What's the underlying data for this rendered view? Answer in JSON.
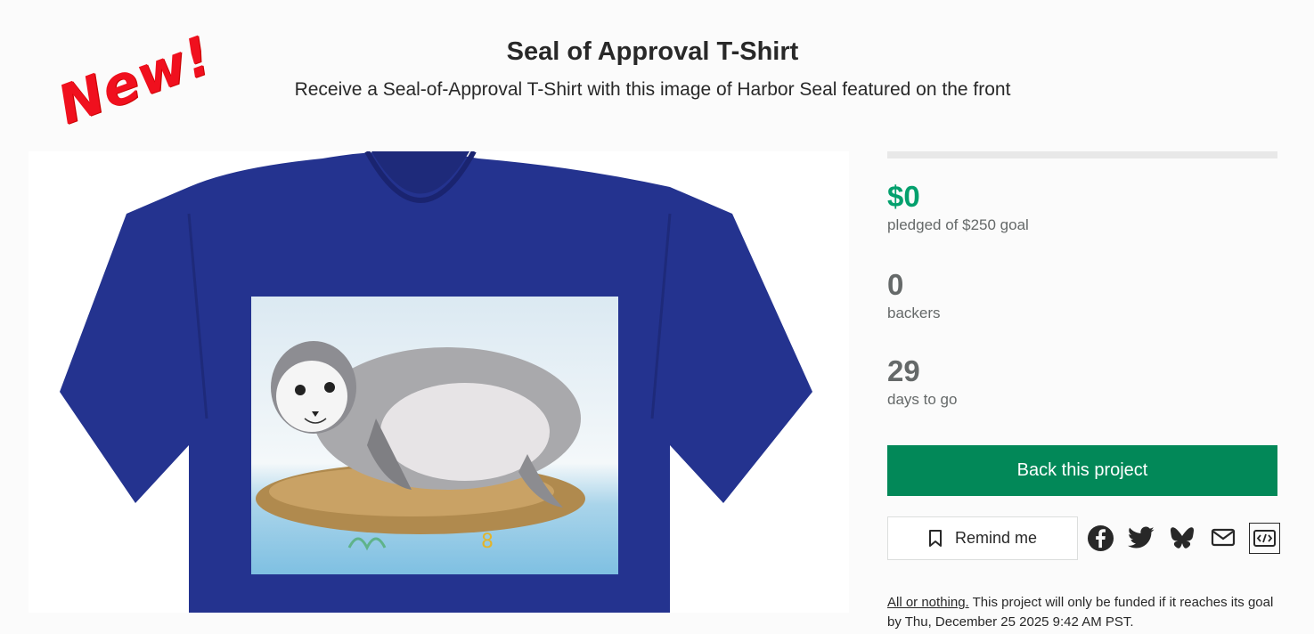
{
  "project": {
    "title": "Seal of Approval T-Shirt",
    "subtitle": "Receive a Seal-of-Approval T-Shirt with this image of Harbor Seal featured on the front",
    "badge": "New!"
  },
  "media": {
    "description_icon": "tshirt-image",
    "shirt_color": "#24338f"
  },
  "stats": {
    "progress_fraction": 0,
    "pledged_amount": "$0",
    "pledged_label": "pledged of $250 goal",
    "backers_count": "0",
    "backers_label": "backers",
    "days_count": "29",
    "days_label": "days to go"
  },
  "actions": {
    "back_label": "Back this project",
    "remind_label": "Remind me",
    "share_icons": [
      "facebook-icon",
      "twitter-icon",
      "bluesky-icon",
      "email-icon",
      "embed-icon"
    ]
  },
  "footnote": {
    "link_text": "All or nothing.",
    "text": "This project will only be funded if it reaches its goal by Thu, December 25 2025 9:42 AM PST."
  },
  "colors": {
    "accent": "#028858",
    "pledged": "#03a06d",
    "badge": "#f0101e"
  }
}
